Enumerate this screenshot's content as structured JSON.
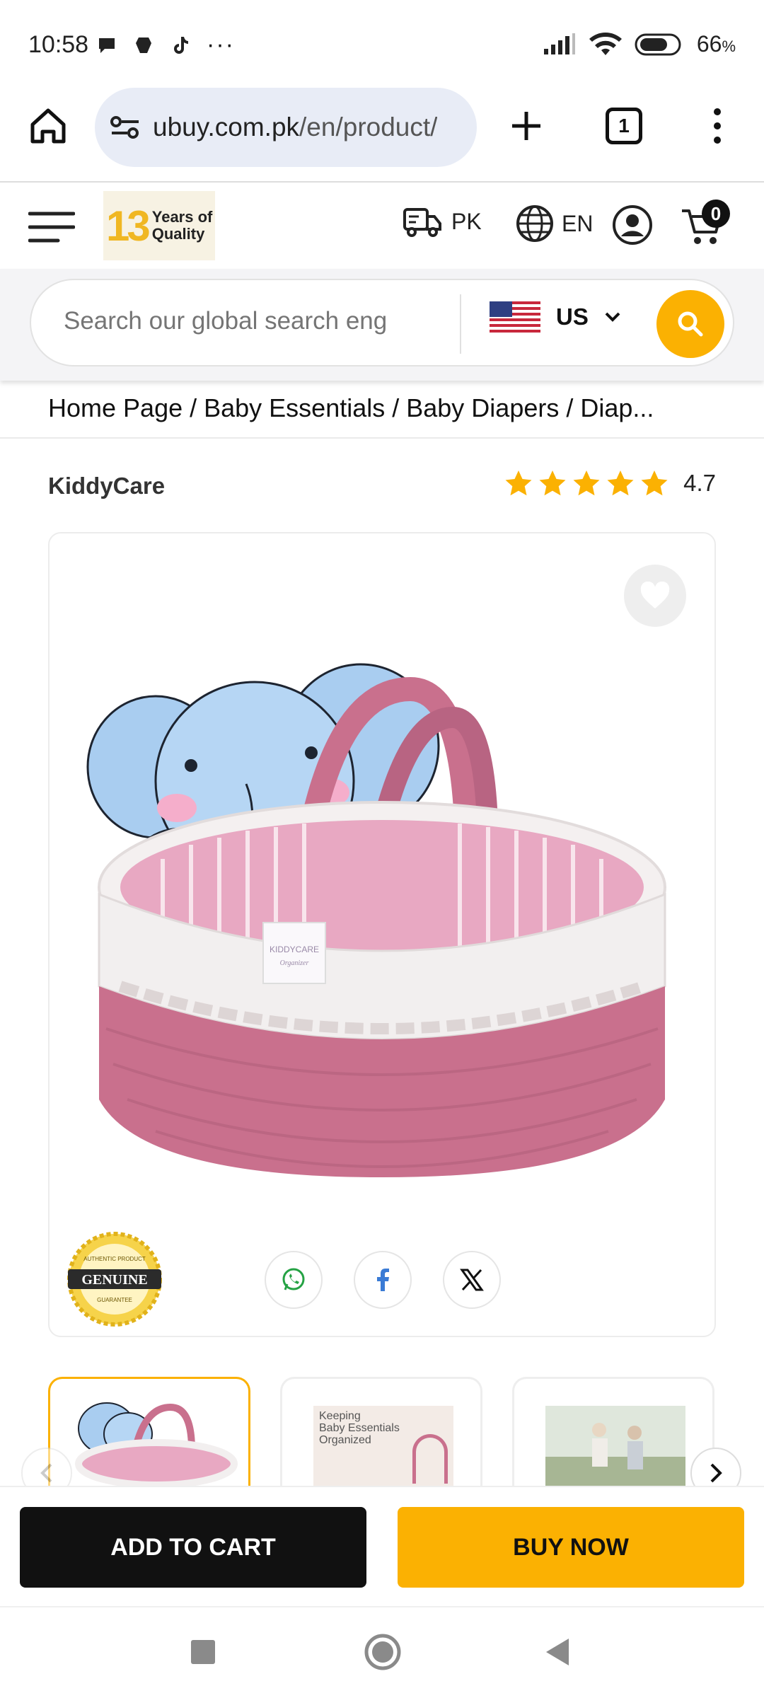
{
  "status_bar": {
    "time": "10:58",
    "battery": "66",
    "battery_unit": "%"
  },
  "browser": {
    "url_domain": "ubuy.com.pk",
    "url_path": "/en/product/",
    "tab_count": "1"
  },
  "header": {
    "logo_number": "13",
    "logo_line1": "Years of",
    "logo_line2": "Quality",
    "shipping_label": "PK",
    "language_label": "EN",
    "cart_count": "0"
  },
  "search": {
    "placeholder": "Search our global search eng",
    "country": "US"
  },
  "breadcrumb": {
    "text": "Home Page / Baby Essentials / Baby Diapers / Diap..."
  },
  "product": {
    "brand": "KiddyCare",
    "rating_value": "4.7",
    "rating_stars": 5,
    "basket_tag_line1": "KIDDYCARE",
    "basket_tag_line2": "Organizer"
  },
  "badge": {
    "top_text": "AUTHENTIC PRODUCT",
    "main_text": "GENUINE",
    "bottom_text": "GUARANTEE"
  },
  "thumbnails": {
    "second_caption_line1": "Keeping",
    "second_caption_line2": "Baby Essentials",
    "second_caption_line3": "Organized"
  },
  "actions": {
    "add_to_cart": "ADD TO CART",
    "buy_now": "BUY NOW"
  },
  "colors": {
    "accent": "#fbb102",
    "dark": "#111111",
    "pink": "#c9708d",
    "elephant_blue": "#a9cdf0"
  }
}
